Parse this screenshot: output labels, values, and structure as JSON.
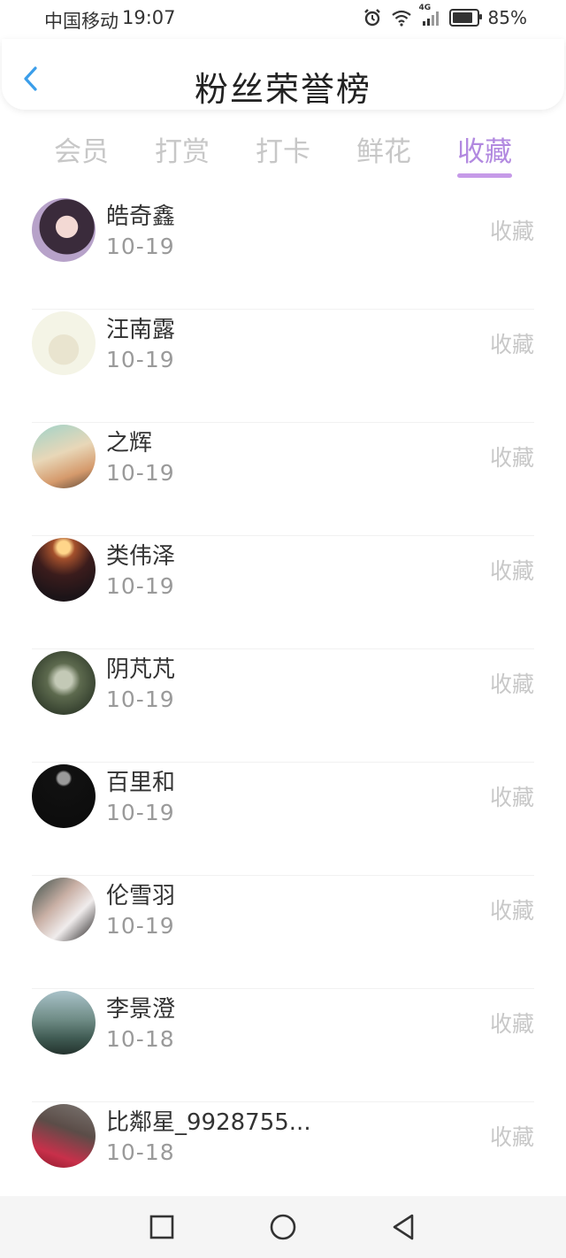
{
  "status_bar": {
    "carrier": "中国移动",
    "time": "19:07",
    "network": "4G",
    "battery_label": "85%",
    "battery_level": 0.85,
    "icons": [
      "alarm-icon",
      "wifi-icon",
      "signal-icon",
      "battery-icon"
    ]
  },
  "header": {
    "title": "粉丝荣誉榜",
    "back_icon": "chevron-left-icon",
    "accent_color": "#3b9eea"
  },
  "tabs": {
    "items": [
      {
        "label": "会员"
      },
      {
        "label": "打赏"
      },
      {
        "label": "打卡"
      },
      {
        "label": "鲜花"
      },
      {
        "label": "收藏"
      }
    ],
    "active_index": 4,
    "active_color": "#b289e0"
  },
  "list": {
    "items": [
      {
        "name": "皓奇鑫",
        "date": "10-19",
        "action": "收藏"
      },
      {
        "name": "汪南露",
        "date": "10-19",
        "action": "收藏"
      },
      {
        "name": "之辉",
        "date": "10-19",
        "action": "收藏"
      },
      {
        "name": "类伟泽",
        "date": "10-19",
        "action": "收藏"
      },
      {
        "name": "阴芃芃",
        "date": "10-19",
        "action": "收藏"
      },
      {
        "name": "百里和",
        "date": "10-19",
        "action": "收藏"
      },
      {
        "name": "伦雪羽",
        "date": "10-19",
        "action": "收藏"
      },
      {
        "name": "李景澄",
        "date": "10-18",
        "action": "收藏"
      },
      {
        "name": "比鄰星_9928755...",
        "date": "10-18",
        "action": "收藏"
      }
    ]
  },
  "nav_bar": {
    "buttons": [
      "square-recents-icon",
      "circle-home-icon",
      "triangle-back-icon"
    ]
  }
}
